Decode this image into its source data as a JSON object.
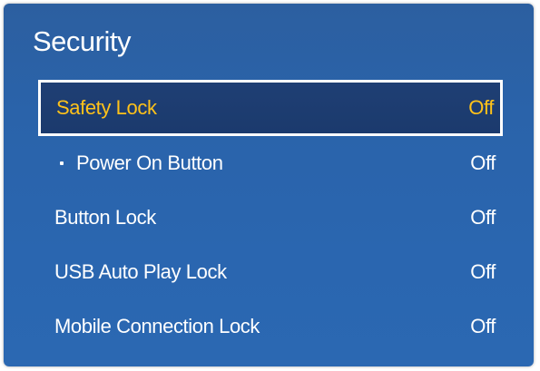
{
  "panel": {
    "title": "Security"
  },
  "menu": {
    "items": [
      {
        "label": "Safety Lock",
        "value": "Off",
        "selected": true,
        "sub": false
      },
      {
        "label": "Power On Button",
        "value": "Off",
        "selected": false,
        "sub": true
      },
      {
        "label": "Button Lock",
        "value": "Off",
        "selected": false,
        "sub": false
      },
      {
        "label": "USB Auto Play Lock",
        "value": "Off",
        "selected": false,
        "sub": false
      },
      {
        "label": "Mobile Connection Lock",
        "value": "Off",
        "selected": false,
        "sub": false
      }
    ]
  },
  "colors": {
    "panel_background": "#2a63aa",
    "selected_background": "#1d3c70",
    "selected_text": "#ffc21a",
    "text": "#ffffff",
    "selected_border": "#ffffff"
  },
  "icons": {
    "sub_item_marker": "bullet-dot-icon"
  }
}
